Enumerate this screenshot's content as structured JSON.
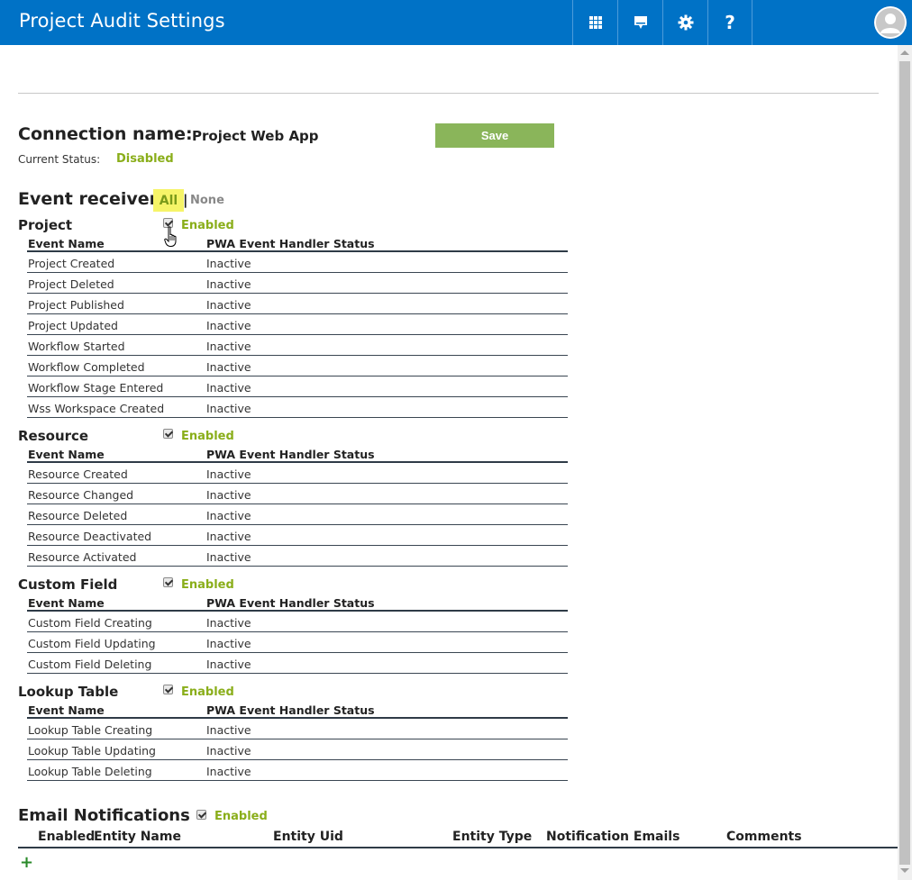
{
  "header": {
    "title": "Project Audit Settings",
    "icons": [
      "app-launcher-icon",
      "chat-icon",
      "gear-icon",
      "help-icon",
      "user-avatar-icon"
    ],
    "help_glyph": "?"
  },
  "colors": {
    "header_bg": "#0072c6",
    "accent_green": "#8aae1a",
    "save_bg": "#8ab55a",
    "highlight": "#f6f468"
  },
  "connection": {
    "label": "Connection name:",
    "value": "Project Web App",
    "save_label": "Save",
    "status_label": "Current Status:",
    "status_value": "Disabled"
  },
  "event_receivers": {
    "title": "Event receivers",
    "all_label": "All",
    "separator": "|",
    "none_label": "None"
  },
  "columns": {
    "event_name": "Event Name",
    "status": "PWA Event Handler Status"
  },
  "sections": [
    {
      "title": "Project",
      "enabled_label": "Enabled",
      "checked": true,
      "rows": [
        {
          "name": "Project Created",
          "status": "Inactive"
        },
        {
          "name": "Project Deleted",
          "status": "Inactive"
        },
        {
          "name": "Project Published",
          "status": "Inactive"
        },
        {
          "name": "Project Updated",
          "status": "Inactive"
        },
        {
          "name": "Workflow Started",
          "status": "Inactive"
        },
        {
          "name": "Workflow Completed",
          "status": "Inactive"
        },
        {
          "name": "Workflow Stage Entered",
          "status": "Inactive"
        },
        {
          "name": "Wss Workspace Created",
          "status": "Inactive"
        }
      ]
    },
    {
      "title": "Resource",
      "enabled_label": "Enabled",
      "checked": true,
      "rows": [
        {
          "name": "Resource Created",
          "status": "Inactive"
        },
        {
          "name": "Resource Changed",
          "status": "Inactive"
        },
        {
          "name": "Resource Deleted",
          "status": "Inactive"
        },
        {
          "name": "Resource Deactivated",
          "status": "Inactive"
        },
        {
          "name": "Resource Activated",
          "status": "Inactive"
        }
      ]
    },
    {
      "title": "Custom Field",
      "enabled_label": "Enabled",
      "checked": true,
      "rows": [
        {
          "name": "Custom Field Creating",
          "status": "Inactive"
        },
        {
          "name": "Custom Field Updating",
          "status": "Inactive"
        },
        {
          "name": "Custom Field Deleting",
          "status": "Inactive"
        }
      ]
    },
    {
      "title": "Lookup Table",
      "enabled_label": "Enabled",
      "checked": true,
      "rows": [
        {
          "name": "Lookup Table Creating",
          "status": "Inactive"
        },
        {
          "name": "Lookup Table Updating",
          "status": "Inactive"
        },
        {
          "name": "Lookup Table Deleting",
          "status": "Inactive"
        }
      ]
    }
  ],
  "email": {
    "title": "Email Notifications",
    "enabled_label": "Enabled",
    "checked": true,
    "columns": [
      "Enabled",
      "Entity Name",
      "Entity Uid",
      "Entity Type",
      "Notification Emails",
      "Comments"
    ],
    "add_label": "+"
  }
}
